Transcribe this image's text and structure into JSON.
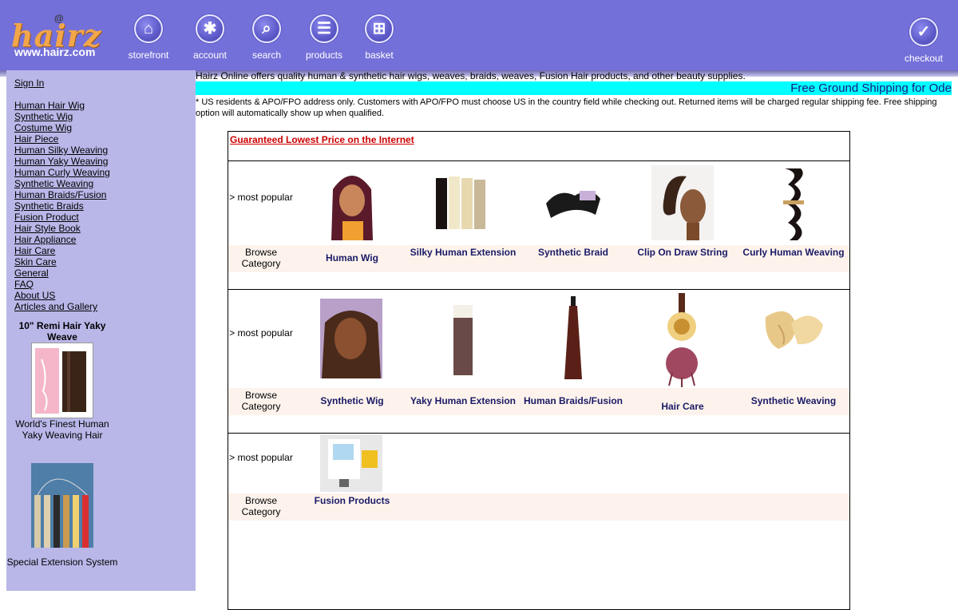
{
  "header": {
    "logo_word": "hairz",
    "logo_at": "@",
    "logo_url": "www.hairz.com",
    "nav": [
      {
        "label": "storefront",
        "icon": "home-icon",
        "glyph": "⌂"
      },
      {
        "label": "account",
        "icon": "asterisk-icon",
        "glyph": "✱"
      },
      {
        "label": "search",
        "icon": "magnifier-icon",
        "glyph": "⌕"
      },
      {
        "label": "products",
        "icon": "document-icon",
        "glyph": "☰"
      },
      {
        "label": "basket",
        "icon": "cart-icon",
        "glyph": "⊞"
      }
    ],
    "checkout": {
      "label": "checkout",
      "icon": "checkmark-icon",
      "glyph": "✓"
    }
  },
  "sidebar": {
    "sign_in": "Sign In",
    "categories": [
      "Human Hair Wig",
      "Synthetic Wig",
      "Costume Wig",
      "Hair Piece",
      "Human Silky Weaving",
      "Human Yaky Weaving",
      "Human Curly Weaving",
      "Synthetic Weaving",
      "Human Braids/Fusion",
      "Synthetic Braids",
      "Fusion Product",
      "Hair Style Book",
      "Hair Appliance",
      "Hair Care",
      "Skin Care",
      "General",
      "FAQ",
      "About US",
      "Articles and Gallery"
    ],
    "promo1_title": "10\" Remi Hair Yaky Weave",
    "promo1_caption": "World's Finest Human Yaky Weaving Hair",
    "promo2_caption": "Special Extension System"
  },
  "main": {
    "intro": "Hairz Online offers quality human & synthetic hair wigs, weaves, braids, weaves, Fusion Hair  products, and other beauty supplies.",
    "shipping_banner": "Free Ground Shipping for Ode",
    "notice": "* US residents & APO/FPO address only. Customers with APO/FPO must choose US in the country field while checking out. Returned items will be charged regular shipping fee. Free shipping option will automatically show up when qualified.",
    "guarantee": "Guaranteed Lowest Price on the Internet",
    "most_popular": "> most popular",
    "browse_category": "Browse Category",
    "rows": [
      [
        "Human Wig",
        "Silky Human Extension",
        "Synthetic Braid",
        "Clip On Draw String",
        "Curly Human Weaving"
      ],
      [
        "Synthetic Wig",
        "Yaky Human Extension",
        "Human Braids/Fusion",
        "Hair Care",
        "Synthetic Weaving"
      ],
      [
        "Fusion Products"
      ]
    ]
  }
}
